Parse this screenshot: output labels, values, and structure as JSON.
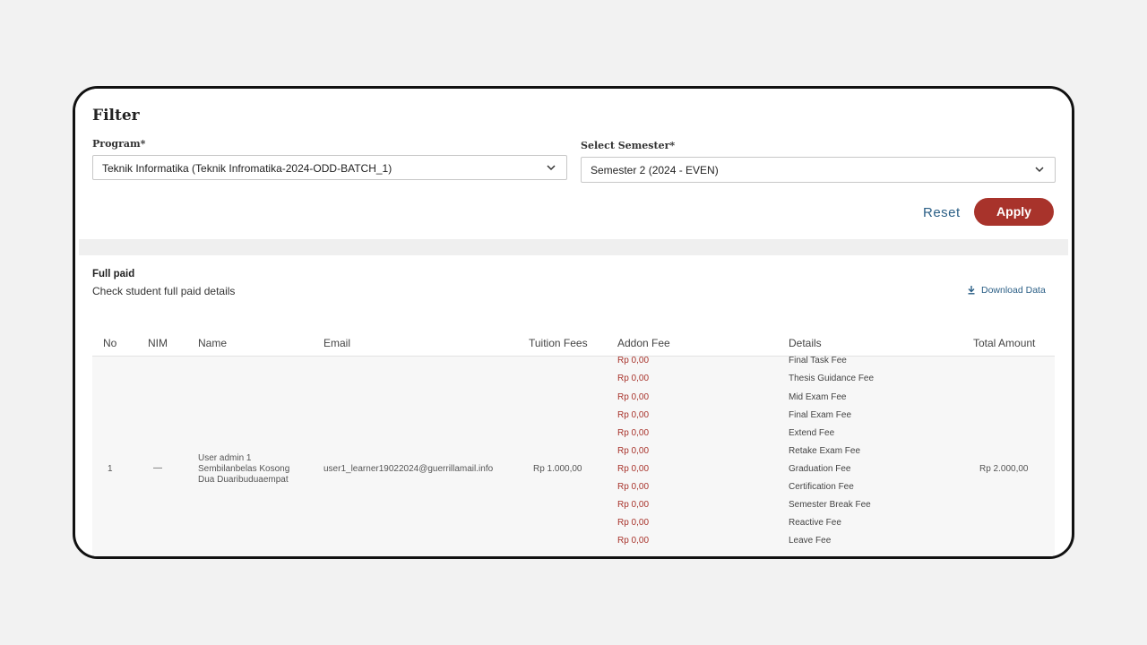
{
  "filter": {
    "title": "Filter",
    "program": {
      "label": "Program*",
      "value": "Teknik Informatika (Teknik Infromatika-2024-ODD-BATCH_1)"
    },
    "semester": {
      "label": "Select Semester*",
      "value": "Semester 2 (2024 - EVEN)"
    },
    "reset_label": "Reset",
    "apply_label": "Apply"
  },
  "section": {
    "title": "Full paid",
    "subtitle": "Check student full paid details",
    "download_label": "Download Data"
  },
  "table": {
    "headers": {
      "no": "No",
      "nim": "NIM",
      "name": "Name",
      "email": "Email",
      "tuition": "Tuition Fees",
      "addon": "Addon Fee",
      "details": "Details",
      "total": "Total Amount"
    },
    "rows": [
      {
        "no": "1",
        "nim": "—",
        "name_lines": [
          "User admin 1",
          "Sembilanbelas Kosong",
          "Dua Duaribuduaempat"
        ],
        "email": "user1_learner19022024@guerrillamail.info",
        "tuition": "Rp 1.000,00",
        "total": "Rp 2.000,00",
        "fees": [
          {
            "amount": "Rp 0,00",
            "name": "Final Task Fee"
          },
          {
            "amount": "Rp 0,00",
            "name": "Thesis Guidance Fee"
          },
          {
            "amount": "Rp 0,00",
            "name": "Mid Exam Fee"
          },
          {
            "amount": "Rp 0,00",
            "name": "Final Exam Fee"
          },
          {
            "amount": "Rp 0,00",
            "name": "Extend Fee"
          },
          {
            "amount": "Rp 0,00",
            "name": "Retake Exam Fee"
          },
          {
            "amount": "Rp 0,00",
            "name": "Graduation Fee"
          },
          {
            "amount": "Rp 0,00",
            "name": "Certification Fee"
          },
          {
            "amount": "Rp 0,00",
            "name": "Semester Break Fee"
          },
          {
            "amount": "Rp 0,00",
            "name": "Reactive Fee"
          },
          {
            "amount": "Rp 0,00",
            "name": "Leave Fee"
          }
        ]
      }
    ]
  },
  "colors": {
    "accent": "#a8332b",
    "link": "#2b5f86"
  }
}
